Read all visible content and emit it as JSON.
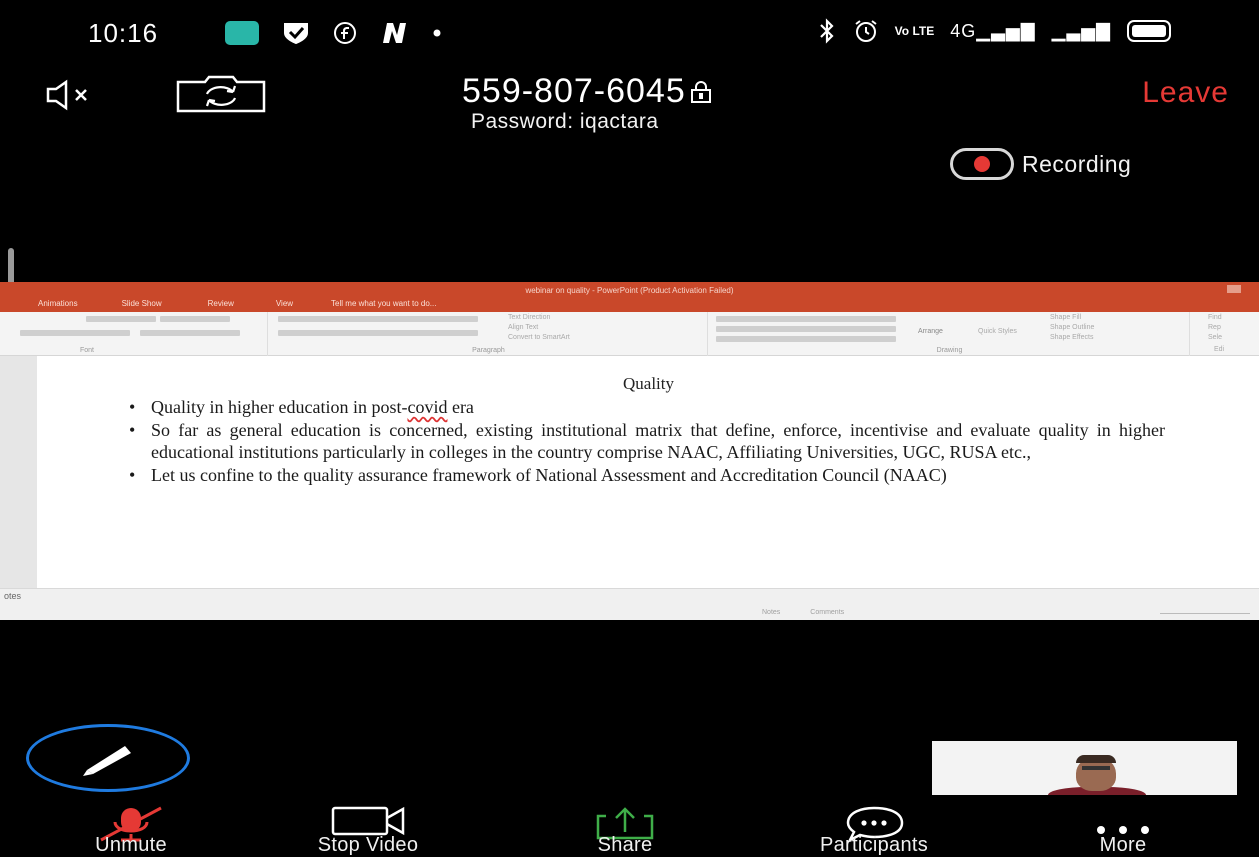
{
  "status_bar": {
    "time": "10:16",
    "icons_left": [
      "message-icon",
      "shield-check-icon",
      "circle-f-icon",
      "n-icon",
      "dot-icon"
    ],
    "icons_right": [
      "bluetooth-icon",
      "alarm-icon",
      "volte-icon",
      "signal-4g-icon",
      "signal-icon",
      "battery-icon"
    ],
    "volte_text": "Vo LTE",
    "network_text": "4G"
  },
  "meeting": {
    "id": "559-807-6045",
    "password_text": "Password: iqactara",
    "leave_label": "Leave",
    "recording_label": "Recording",
    "colors": {
      "leave": "#e53935",
      "accent": "#1f7be0",
      "share": "#3fae49"
    }
  },
  "shared_screen": {
    "window_title": "webinar on quality - PowerPoint (Product Activation Failed)",
    "ribbon_tabs": [
      "Animations",
      "Slide Show",
      "Review",
      "View",
      "Tell me what you want to do..."
    ],
    "ribbon_groups": {
      "font": "Font",
      "paragraph": "Paragraph",
      "drawing": "Drawing"
    },
    "ribbon_items": {
      "text_direction": "Text Direction",
      "align_text": "Align Text",
      "convert_smartart": "Convert to SmartArt",
      "arrange": "Arrange",
      "quick_styles": "Quick Styles",
      "shape_fill": "Shape Fill",
      "shape_outline": "Shape Outline",
      "shape_effects": "Shape Effects",
      "find": "Find",
      "replace": "Rep",
      "select": "Sele",
      "edit": "Edi"
    },
    "slide": {
      "title": "Quality",
      "bullets": [
        {
          "pre": "Quality in  higher education in post-",
          "squiggle": "covid",
          "post": " era"
        },
        {
          "pre": "So far as general education is concerned, existing institutional matrix that define, enforce, incentivise and evaluate quality in higher educational institutions particularly in colleges in the country comprise NAAC, Affiliating Universities, UGC, RUSA etc.,",
          "squiggle": "",
          "post": ""
        },
        {
          "pre": "Let us confine to the quality assurance framework of National Assessment and Accreditation Council (NAAC)",
          "squiggle": "",
          "post": ""
        }
      ]
    },
    "notes_label": "otes",
    "statusbar_items": [
      "Notes",
      "Comments"
    ]
  },
  "toolbar": {
    "unmute": "Unmute",
    "stop_video": "Stop Video",
    "share": "Share",
    "participants": "Participants",
    "more": "More"
  }
}
